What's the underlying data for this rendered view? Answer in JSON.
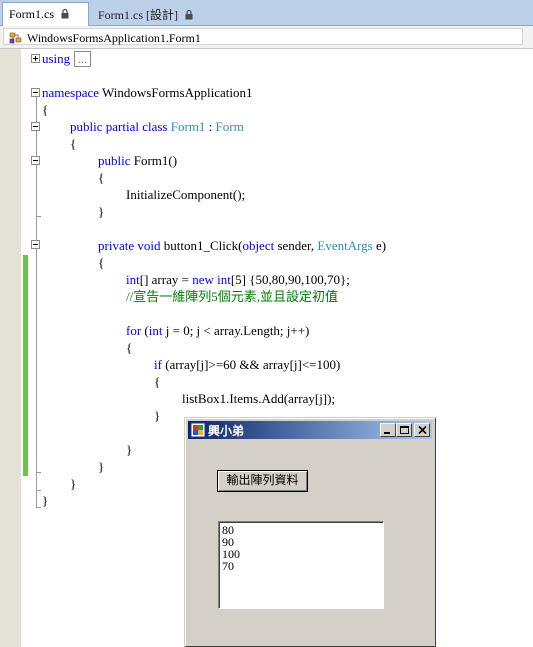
{
  "tabs": [
    {
      "label": "Form1.cs",
      "active": true,
      "icon": "lock-icon"
    },
    {
      "label": "Form1.cs [設計]",
      "active": false,
      "icon": "lock-icon"
    }
  ],
  "navbar": {
    "class_path": "WindowsFormsApplication1.Form1",
    "icon": "class-icon"
  },
  "code": {
    "l1_kw": "using",
    "l1_collapsed": "...",
    "l3_kw": "namespace",
    "l3_rest": " WindowsFormsApplication1",
    "l4": "{",
    "l5_kw": "public partial class",
    "l5_cls": "Form1",
    "l5_colon": " : ",
    "l5_base": "Form",
    "l6": "{",
    "l7_kw": "public",
    "l7_rest": " Form1()",
    "l8": "{",
    "l9": "InitializeComponent();",
    "l10": "}",
    "l12_kw1": "private",
    "l12_kw2": "void",
    "l12_mid": " button1_Click(",
    "l12_kw3": "object",
    "l12_mid2": " sender, ",
    "l12_ty": "EventArgs",
    "l12_end": " e)",
    "l13": "{",
    "l14_kw1": "int",
    "l14_a": "[] array = ",
    "l14_kw2": "new",
    "l14_kw3": "int",
    "l14_b": "[5] {50,80,90,100,70};",
    "l15_comment": "//宣告一維陣列5個元素,並且設定初值",
    "l17_kw1": "for",
    "l17_a": " (",
    "l17_kw2": "int",
    "l17_b": " j = 0; j < array.Length; j++)",
    "l18": "{",
    "l19_kw": "if",
    "l19_rest": " (array[j]>=60 && array[j]<=100)",
    "l20": "{",
    "l21": "listBox1.Items.Add(array[j]);",
    "l22": "}",
    "l24": "}",
    "l25": "}",
    "l26": "}",
    "l27": "}"
  },
  "form_window": {
    "title": "興小弟",
    "button_label": "輸出陣列資料",
    "list_items": [
      "80",
      "90",
      "100",
      "70"
    ]
  },
  "colors": {
    "keyword": "#0000ff",
    "type": "#2b91af",
    "comment": "#008000",
    "titlebar_start": "#0a246a",
    "titlebar_end": "#a6caf0"
  }
}
